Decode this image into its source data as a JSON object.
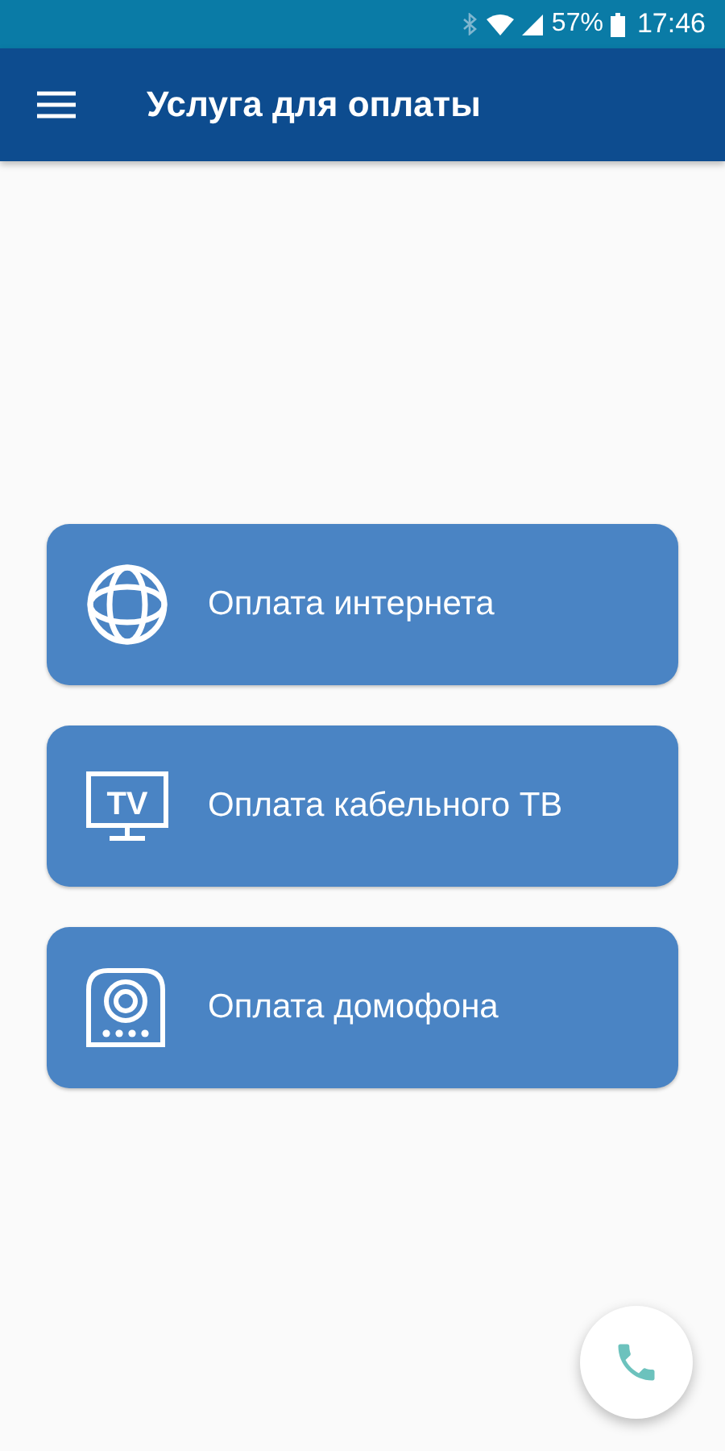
{
  "status_bar": {
    "battery": "57%",
    "time": "17:46"
  },
  "app_bar": {
    "title": "Услуга для оплаты"
  },
  "services": [
    {
      "kind": "globe",
      "label": "Оплата интернета"
    },
    {
      "kind": "tv",
      "label": "Оплата кабельного ТВ",
      "icon_text": "TV"
    },
    {
      "kind": "intercom",
      "label": "Оплата домофона"
    }
  ]
}
